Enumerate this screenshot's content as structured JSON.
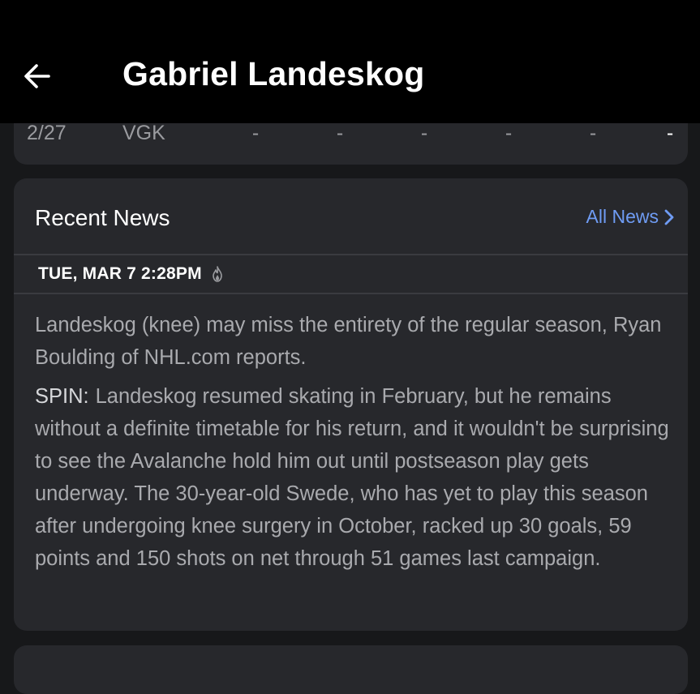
{
  "header": {
    "title": "Gabriel Landeskog",
    "back_icon": "arrow-left-icon"
  },
  "game_log": {
    "row": {
      "date": "2/27",
      "opponent": "VGK",
      "stats": [
        "-",
        "-",
        "-",
        "-",
        "-",
        "-"
      ]
    }
  },
  "news": {
    "section_title": "Recent News",
    "all_news_label": "All News",
    "item": {
      "timestamp": "TUE, MAR 7 2:28PM",
      "hot_icon": "flame-icon",
      "headline": "Landeskog (knee) may miss the entirety of the regular season, Ryan Boulding of NHL.com reports.",
      "spin_label": "SPIN:",
      "spin_text": "Landeskog resumed skating in February, but he remains without a definite timetable for his return, and it wouldn't be surprising to see the Avalanche hold him out until postseason play gets underway. The 30-year-old Swede, who has yet to play this season after undergoing knee surgery in October, racked up 30 goals, 59 points and 150 shots on net through 51 games last campaign."
    }
  },
  "colors": {
    "background": "#17181a",
    "card": "#27282c",
    "header": "#000000",
    "link": "#6f9cf4"
  }
}
